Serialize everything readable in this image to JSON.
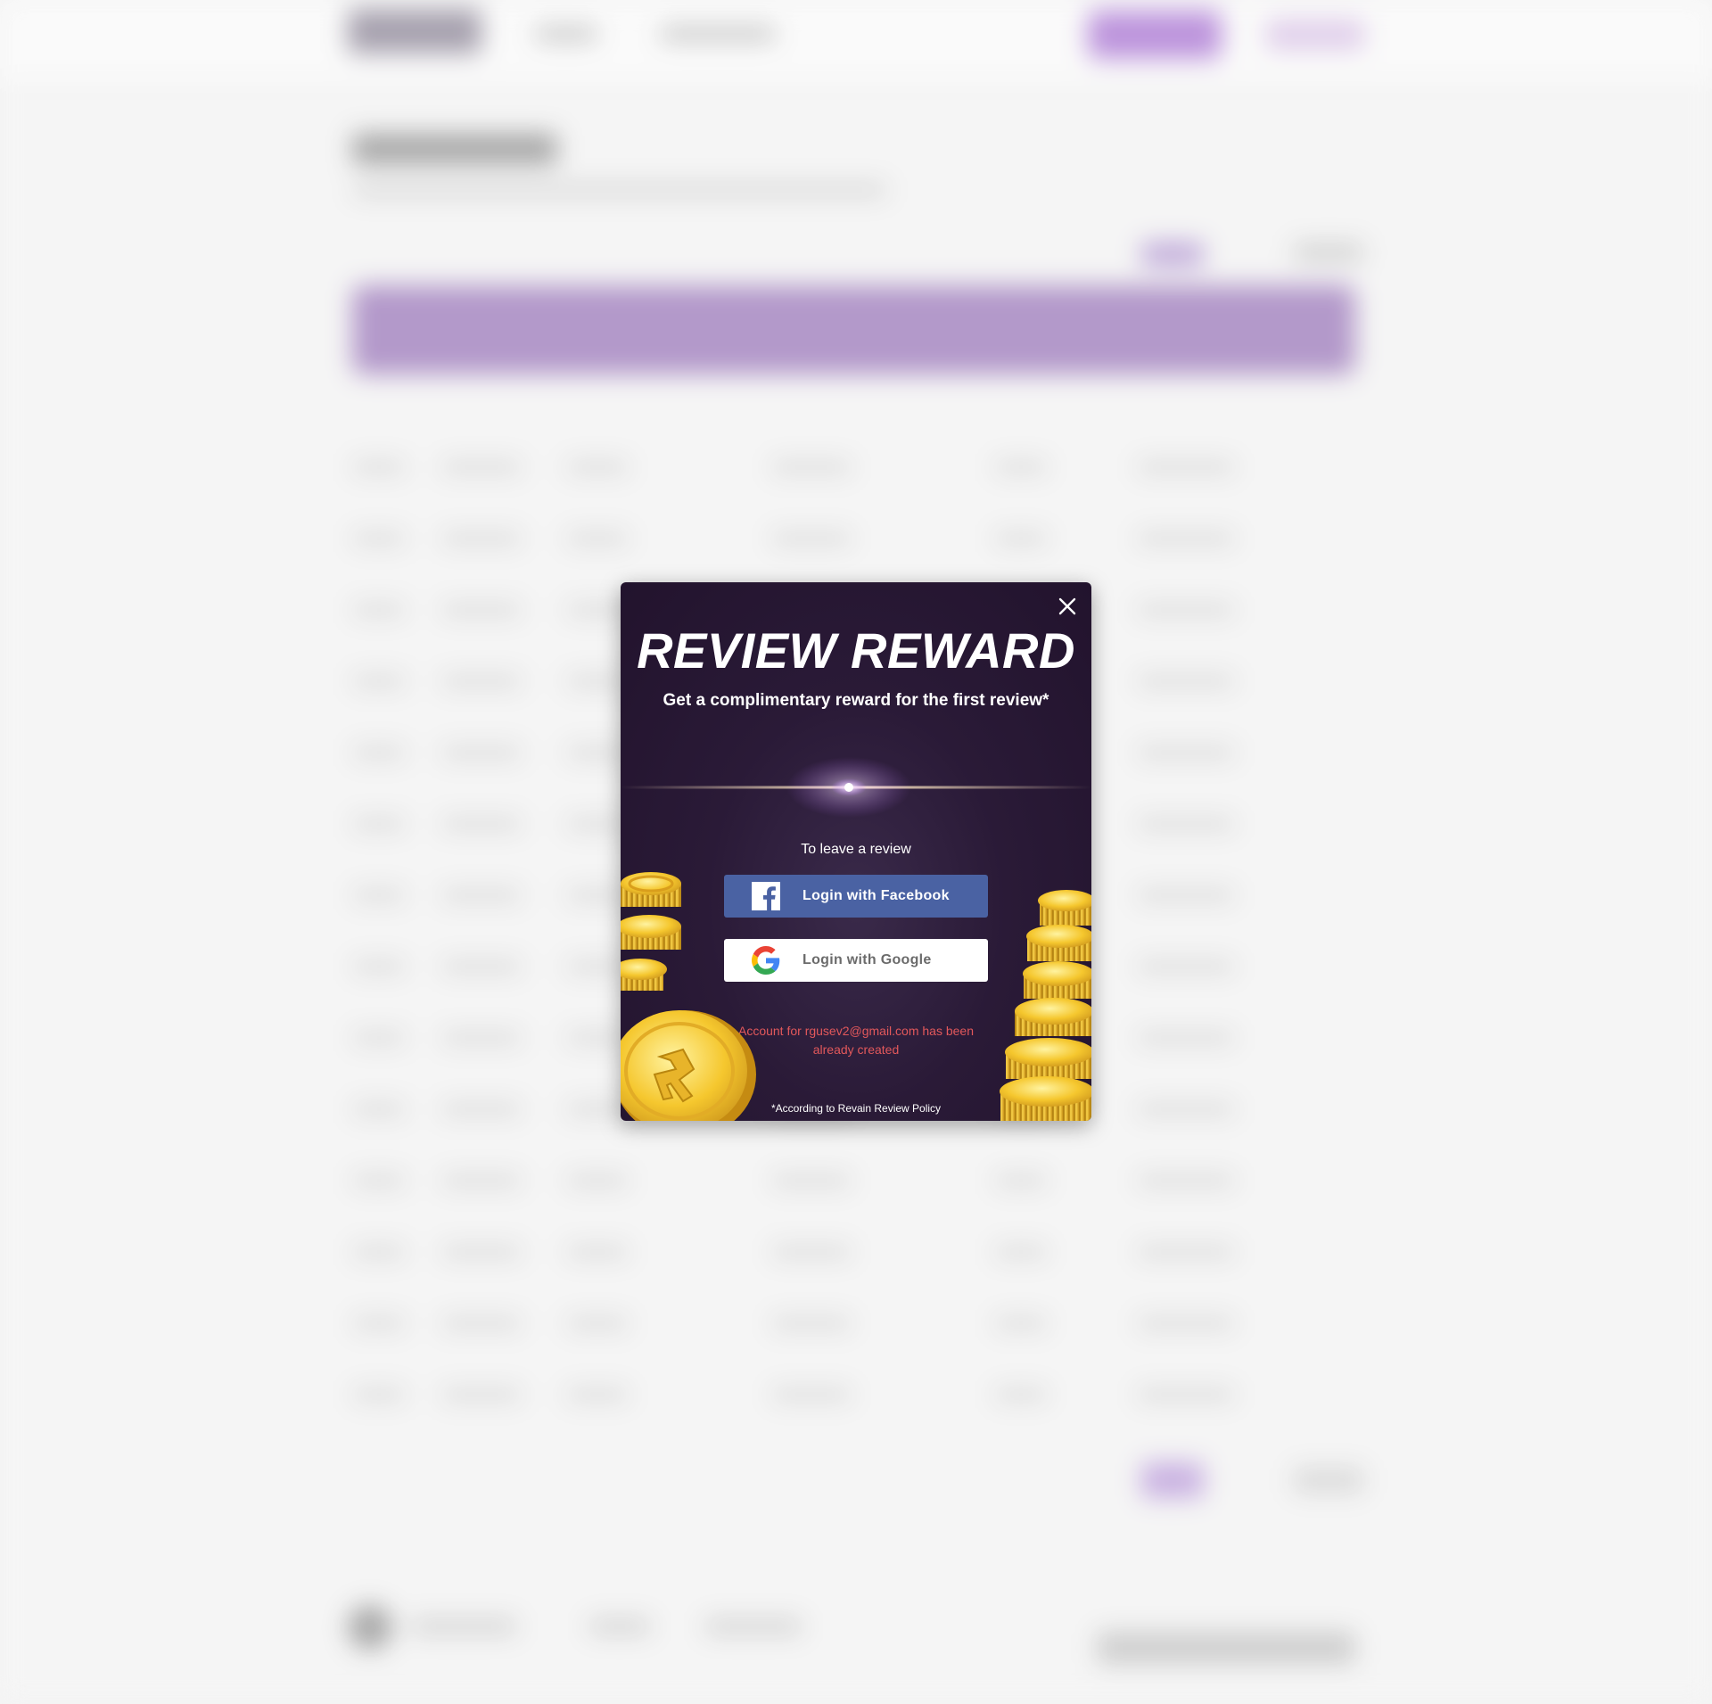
{
  "modal": {
    "title": "REVIEW REWARD",
    "subtitle": "Get a complimentary reward for the first review*",
    "leave_review_text": "To leave a review",
    "facebook_button": {
      "label": "Login with Facebook",
      "icon": "facebook-icon"
    },
    "google_button": {
      "label": "Login with Google",
      "icon": "google-icon"
    },
    "error_message": "Account for rgusev2@gmail.com has been already created",
    "policy_note": "*According to Revain Review Policy",
    "close_icon": "close-icon",
    "colors": {
      "background": "#2a1a37",
      "facebook": "#4a62a3",
      "error": "#e2585b",
      "coin_gold": "#f2c12e"
    }
  }
}
